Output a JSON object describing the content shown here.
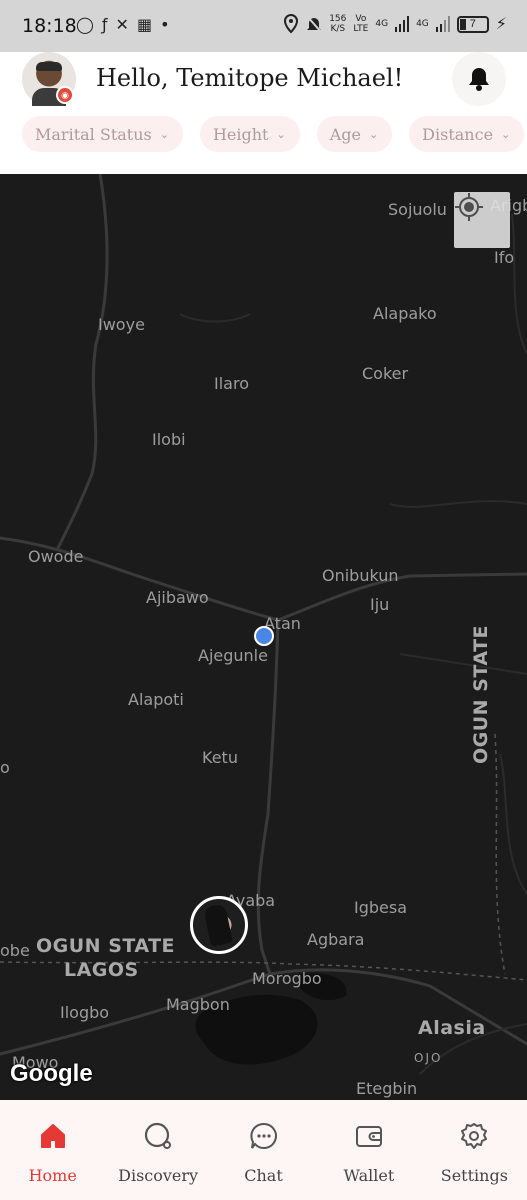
{
  "status_bar": {
    "time": "18:18",
    "speed_value": "156",
    "speed_unit": "K/S",
    "volte_line1": "Vo",
    "volte_line2": "LTE",
    "network_1": "4G",
    "network_2": "4G",
    "battery_level": "7"
  },
  "header": {
    "greeting": "Hello, Temitope Michael!",
    "filters": [
      "Marital Status",
      "Height",
      "Age",
      "Distance"
    ]
  },
  "map": {
    "places": {
      "sojuolu": "Sojuolu",
      "arigb": "Arigb",
      "ifo": "Ifo",
      "iwoye": "Iwoye",
      "alapako": "Alapako",
      "coker": "Coker",
      "ilaro": "Ilaro",
      "ilobi": "Ilobi",
      "owode": "Owode",
      "onibukun": "Onibukun",
      "ajibawo": "Ajibawo",
      "iju": "Iju",
      "atan": "Atan",
      "ajegunle": "Ajegunle",
      "alapoti": "Alapoti",
      "ketu": "Ketu",
      "o_edge": "o",
      "ogun_state_vertical": "OGUN STATE",
      "ayaba": "Ayaba",
      "igbesa": "Igbesa",
      "obe": "obe",
      "ogun_state": "OGUN STATE",
      "lagos": "LAGOS",
      "agbara": "Agbara",
      "morogbo": "Morogbo",
      "magbon": "Magbon",
      "ilogbo": "Ilogbo",
      "alasia": "Alasia",
      "ojo": "OJO",
      "mowo": "Mowo",
      "etegbin": "Etegbin"
    },
    "attribution": "Google"
  },
  "bottom_nav": {
    "items": [
      {
        "label": "Home",
        "icon": "home-icon",
        "active": true
      },
      {
        "label": "Discovery",
        "icon": "discovery-icon",
        "active": false
      },
      {
        "label": "Chat",
        "icon": "chat-icon",
        "active": false
      },
      {
        "label": "Wallet",
        "icon": "wallet-icon",
        "active": false
      },
      {
        "label": "Settings",
        "icon": "gear-icon",
        "active": false
      }
    ]
  },
  "colors": {
    "accent": "#e53935",
    "map_background": "#1b1b1b",
    "chip_background": "#fcefef",
    "nav_background": "#fdf6f5",
    "user_location": "#4a86e8"
  }
}
